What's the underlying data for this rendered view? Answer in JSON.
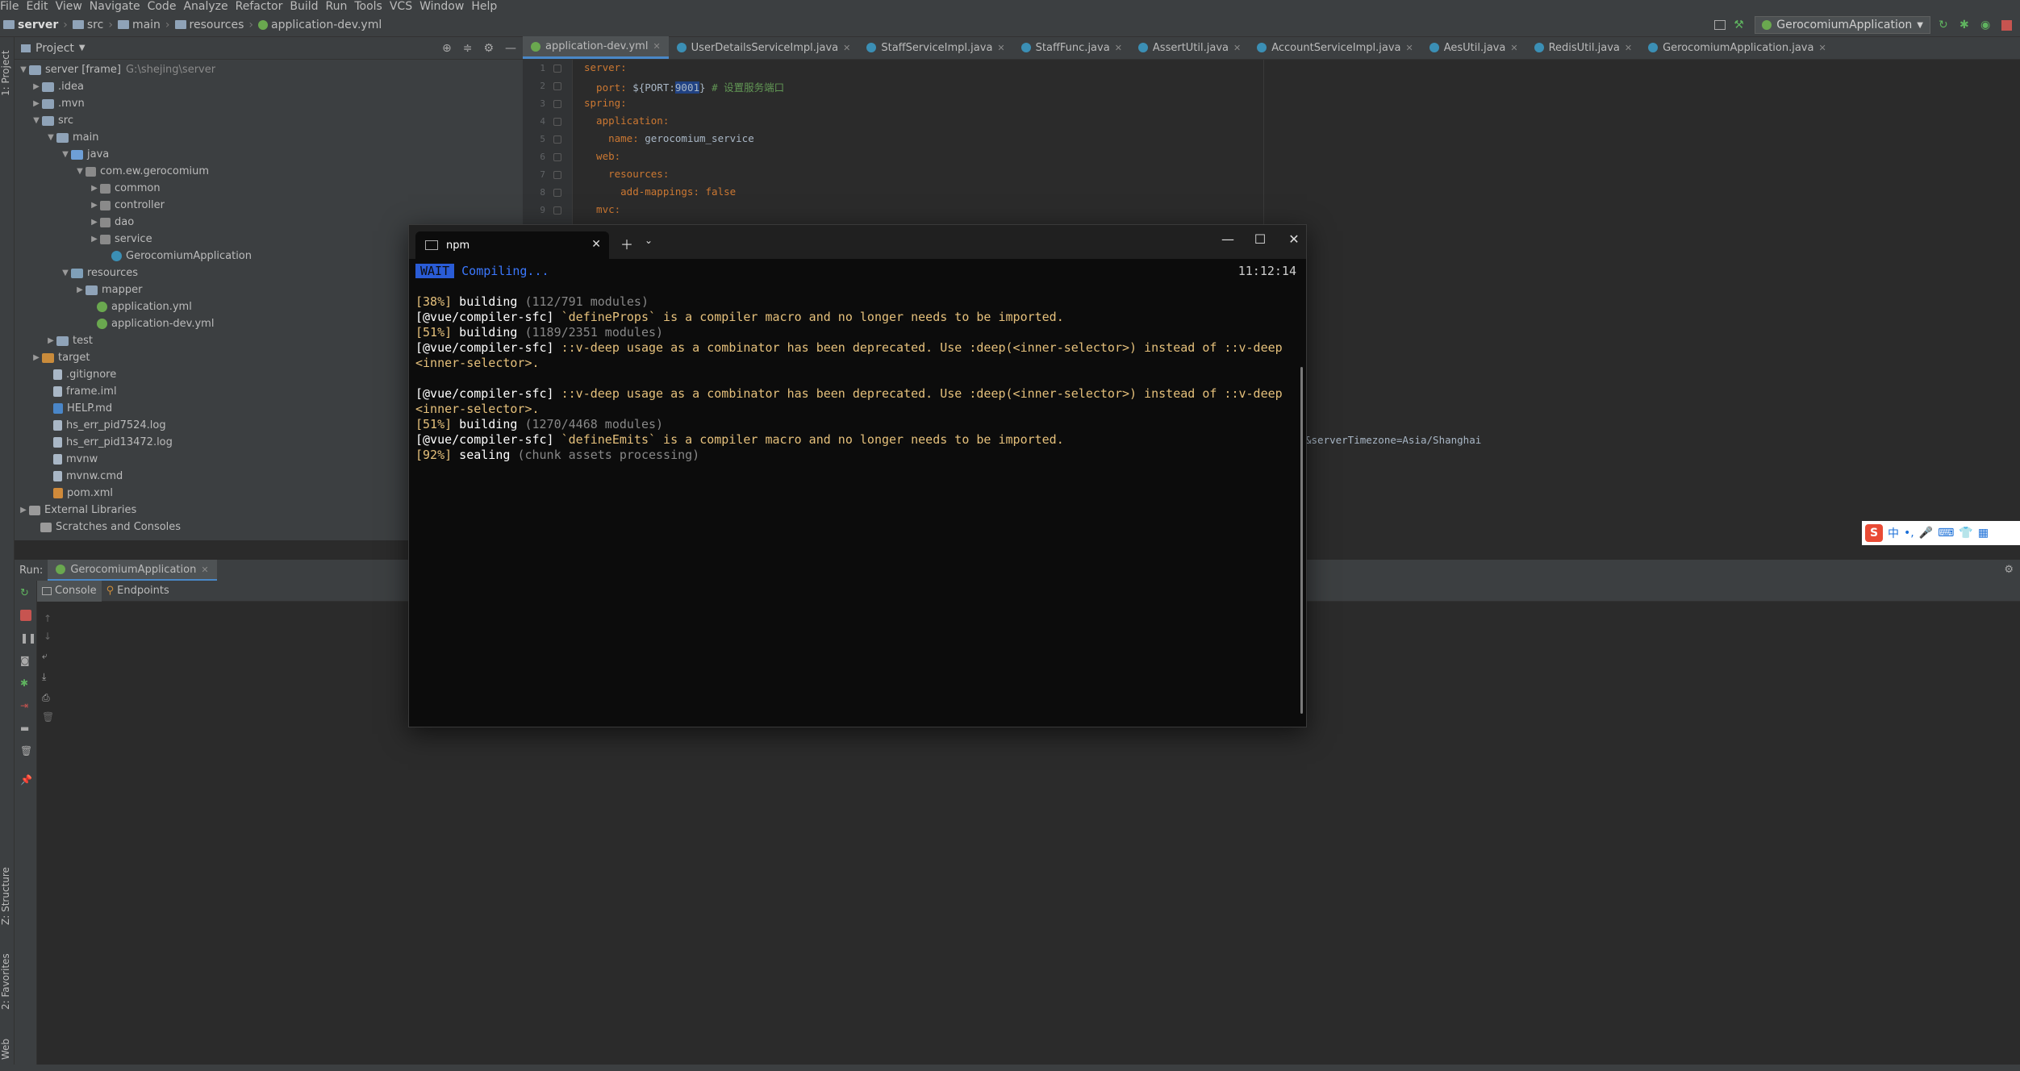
{
  "menu": [
    "File",
    "Edit",
    "View",
    "Navigate",
    "Code",
    "Analyze",
    "Refactor",
    "Build",
    "Run",
    "Tools",
    "VCS",
    "Window",
    "Help"
  ],
  "breadcrumb": [
    "server",
    "src",
    "main",
    "resources",
    "application-dev.yml"
  ],
  "run_config": "GerocomiumApplication",
  "left_strip": {
    "project": "1: Project",
    "structure": "Z: Structure",
    "favorites": "2: Favorites",
    "web": "Web"
  },
  "project": {
    "header": "Project",
    "tree": [
      {
        "label": "server [frame]",
        "path": "G:\\shejing\\server"
      },
      {
        "label": ".idea"
      },
      {
        "label": ".mvn"
      },
      {
        "label": "src"
      },
      {
        "label": "main"
      },
      {
        "label": "java"
      },
      {
        "label": "com.ew.gerocomium"
      },
      {
        "label": "common"
      },
      {
        "label": "controller"
      },
      {
        "label": "dao"
      },
      {
        "label": "service"
      },
      {
        "label": "GerocomiumApplication"
      },
      {
        "label": "resources"
      },
      {
        "label": "mapper"
      },
      {
        "label": "application.yml"
      },
      {
        "label": "application-dev.yml"
      },
      {
        "label": "test"
      },
      {
        "label": "target"
      },
      {
        "label": ".gitignore"
      },
      {
        "label": "frame.iml"
      },
      {
        "label": "HELP.md"
      },
      {
        "label": "hs_err_pid7524.log"
      },
      {
        "label": "hs_err_pid13472.log"
      },
      {
        "label": "mvnw"
      },
      {
        "label": "mvnw.cmd"
      },
      {
        "label": "pom.xml"
      },
      {
        "label": "External Libraries"
      },
      {
        "label": "Scratches and Consoles"
      }
    ]
  },
  "editor": {
    "tabs": [
      "application-dev.yml",
      "UserDetailsServiceImpl.java",
      "StaffServiceImpl.java",
      "StaffFunc.java",
      "AssertUtil.java",
      "AccountServiceImpl.java",
      "AesUtil.java",
      "RedisUtil.java",
      "GerocomiumApplication.java"
    ],
    "lines": [
      {
        "n": "1",
        "key": "server:",
        "val": ""
      },
      {
        "n": "2",
        "key": "  port: ",
        "val": "${PORT:",
        "sel": "9001",
        "rest": "}",
        "comment": " # 设置服务端口"
      },
      {
        "n": "3",
        "key": "spring:",
        "val": ""
      },
      {
        "n": "4",
        "key": "  application:",
        "val": ""
      },
      {
        "n": "5",
        "key": "    name: ",
        "val": "gerocomium_service"
      },
      {
        "n": "6",
        "key": "  web:",
        "val": ""
      },
      {
        "n": "7",
        "key": "    resources:",
        "val": ""
      },
      {
        "n": "8",
        "key": "      add-mappings: ",
        "val": "false"
      },
      {
        "n": "9",
        "key": "  mvc:",
        "val": ""
      }
    ],
    "partial_text": "&serverTimezone=Asia/Shanghai"
  },
  "ime": {
    "logo": "S",
    "lang": "中"
  },
  "run": {
    "label": "Run:",
    "tab": "GerocomiumApplication",
    "subtabs": [
      "Console",
      "Endpoints"
    ]
  },
  "terminal": {
    "tab_title": "npm",
    "status_badge": "WAIT",
    "status_text": "Compiling...",
    "time": "11:12:14",
    "lines": [
      {
        "pct": "[38%]",
        "word": " building ",
        "detail": "(112/791 modules)"
      },
      {
        "tag": "[@vue/compiler-sfc]",
        "msg": " `defineProps` is a compiler macro and no longer needs to be imported."
      },
      {
        "pct": "[51%]",
        "word": " building ",
        "detail": "(1189/2351 modules)"
      },
      {
        "tag": "[@vue/compiler-sfc]",
        "msg": " ::v-deep usage as a combinator has been deprecated. Use :deep(<inner-selector>) instead of ::v-deep"
      },
      {
        "msg_only": "<inner-selector>."
      },
      {
        "blank": ""
      },
      {
        "tag": "[@vue/compiler-sfc]",
        "msg": " ::v-deep usage as a combinator has been deprecated. Use :deep(<inner-selector>) instead of ::v-deep"
      },
      {
        "msg_only": "<inner-selector>."
      },
      {
        "pct": "[51%]",
        "word": " building ",
        "detail": "(1270/4468 modules)"
      },
      {
        "tag": "[@vue/compiler-sfc]",
        "msg": " `defineEmits` is a compiler macro and no longer needs to be imported."
      },
      {
        "pct": "[92%]",
        "word": " sealing ",
        "detail": "(chunk assets processing)"
      }
    ]
  }
}
